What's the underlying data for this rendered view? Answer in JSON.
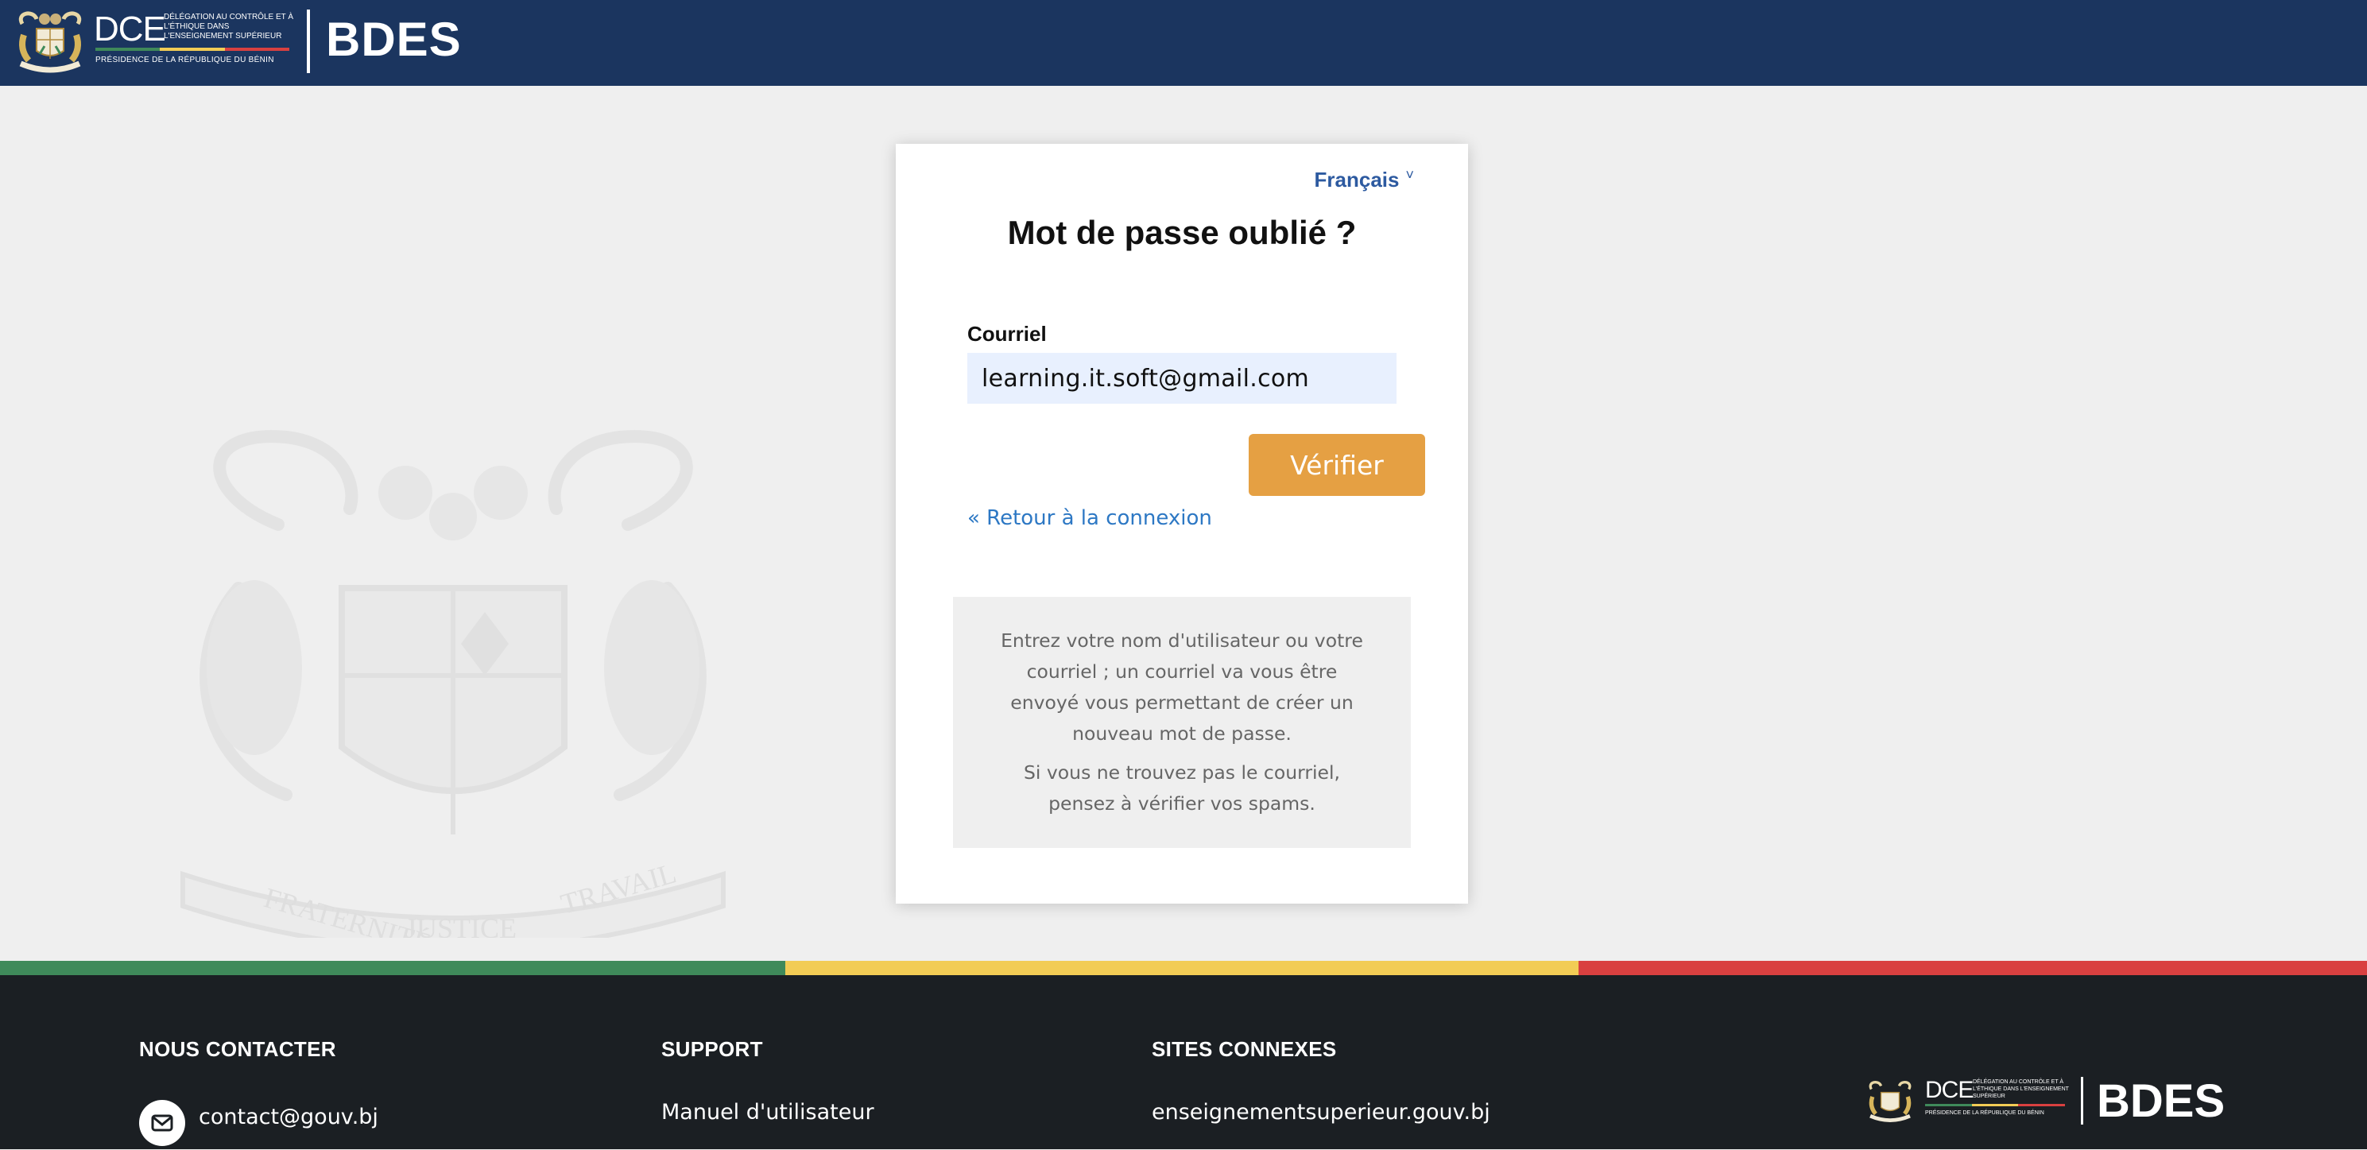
{
  "header": {
    "dce_letters": "DCE",
    "dce_subtitle": "Délégation au contrôle et à l'éthique dans l'enseignement supérieur",
    "presidency": "Présidence de la République du Bénin",
    "title": "BDES"
  },
  "colors": {
    "header_bg": "#1b355f",
    "accent_orange": "#e5a043",
    "link_blue": "#2d78c4",
    "flag_green": "#3f8a5a",
    "flag_yellow": "#f2cc55",
    "flag_red": "#d94040",
    "footer_bg": "#1b1f23"
  },
  "watermark": {
    "motto": [
      "FRATERNITÉ",
      "JUSTICE",
      "TRAVAIL"
    ]
  },
  "form": {
    "language": "Français",
    "language_caret": "˅",
    "title": "Mot de passe oublié ?",
    "email_label": "Courriel",
    "email_value": "learning.it.soft@gmail.com",
    "submit_label": "Vérifier",
    "back_link": "« Retour à la connexion",
    "info_paragraph_1": "Entrez votre nom d'utilisateur ou votre courriel ; un courriel va vous être envoyé vous permettant de créer un nouveau mot de passe.",
    "info_paragraph_2": "Si vous ne trouvez pas le courriel, pensez à vérifier vos spams."
  },
  "footer": {
    "contact_heading": "NOUS CONTACTER",
    "contact_email": "contact@gouv.bj",
    "support_heading": "SUPPORT",
    "support_link": "Manuel d'utilisateur",
    "sites_heading": "SITES CONNEXES",
    "sites_link": "enseignementsuperieur.gouv.bj",
    "logo_title": "BDES",
    "logo_dce": "DCE",
    "logo_subtitle": "Délégation au contrôle et à l'éthique dans l'enseignement supérieur",
    "logo_presidency": "Présidence de la République du Bénin"
  }
}
